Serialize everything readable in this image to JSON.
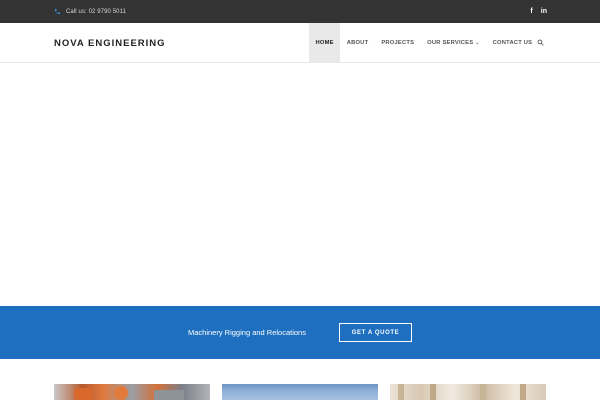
{
  "topbar": {
    "phone_icon": "phone-icon",
    "call_text": "Call us: 02 9790 5011",
    "social": [
      {
        "icon": "facebook-icon",
        "glyph": "f"
      },
      {
        "icon": "linkedin-icon",
        "glyph": "in"
      }
    ]
  },
  "header": {
    "logo": "NOVA ENGINEERING",
    "nav": [
      {
        "label": "HOME",
        "active": true
      },
      {
        "label": "ABOUT",
        "active": false
      },
      {
        "label": "PROJECTS",
        "active": false
      },
      {
        "label": "OUR SERVICES",
        "active": false,
        "has_dropdown": true
      },
      {
        "label": "CONTACT US",
        "active": false
      }
    ],
    "search_icon": "search-icon"
  },
  "cta": {
    "text": "Machinery Rigging and Relocations",
    "button_label": "GET A QUOTE"
  },
  "colors": {
    "topbar_bg": "#333333",
    "accent_blue": "#1e6fc0",
    "active_nav_bg": "#e9e9e9"
  }
}
